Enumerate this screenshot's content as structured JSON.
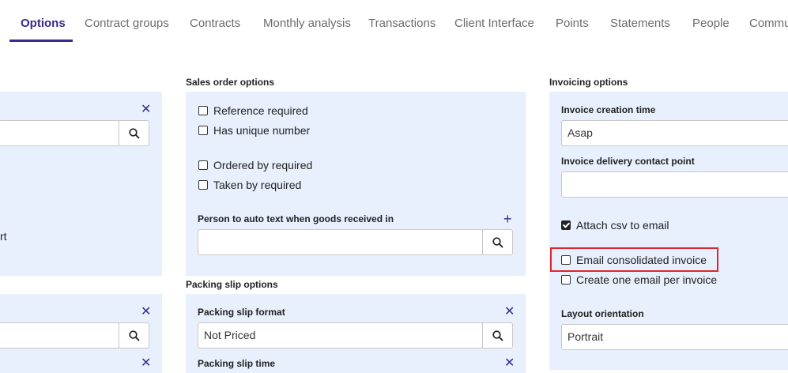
{
  "tabs": [
    {
      "label": "Options",
      "active": true
    },
    {
      "label": "Contract groups"
    },
    {
      "label": "Contracts"
    },
    {
      "label": "Monthly analysis"
    },
    {
      "label": "Transactions"
    },
    {
      "label": "Client Interface"
    },
    {
      "label": "Points"
    },
    {
      "label": "Statements"
    },
    {
      "label": "People"
    },
    {
      "label": "Commu"
    }
  ],
  "left_column": {
    "partial_text": "rt"
  },
  "sales_order": {
    "title": "Sales order options",
    "reference_required": "Reference required",
    "has_unique_number": "Has unique number",
    "ordered_by_required": "Ordered by required",
    "taken_by_required": "Taken by required",
    "auto_text_label": "Person to auto text when goods received in",
    "auto_text_value": ""
  },
  "packing_slip": {
    "title": "Packing slip options",
    "format_label": "Packing slip format",
    "format_value": "Not Priced",
    "time_label": "Packing slip time"
  },
  "invoicing": {
    "title": "Invoicing options",
    "creation_time_label": "Invoice creation time",
    "creation_time_value": "Asap",
    "delivery_contact_label": "Invoice delivery contact point",
    "delivery_contact_value": "",
    "attach_csv": "Attach csv to email",
    "email_consolidated": "Email consolidated invoice",
    "one_email_per_invoice": "Create one email per invoice",
    "layout_label": "Layout orientation",
    "layout_value": "Portrait"
  },
  "colors": {
    "accent": "#3b2a8f",
    "panel": "#e7f0fc",
    "highlight": "#e0262b"
  }
}
